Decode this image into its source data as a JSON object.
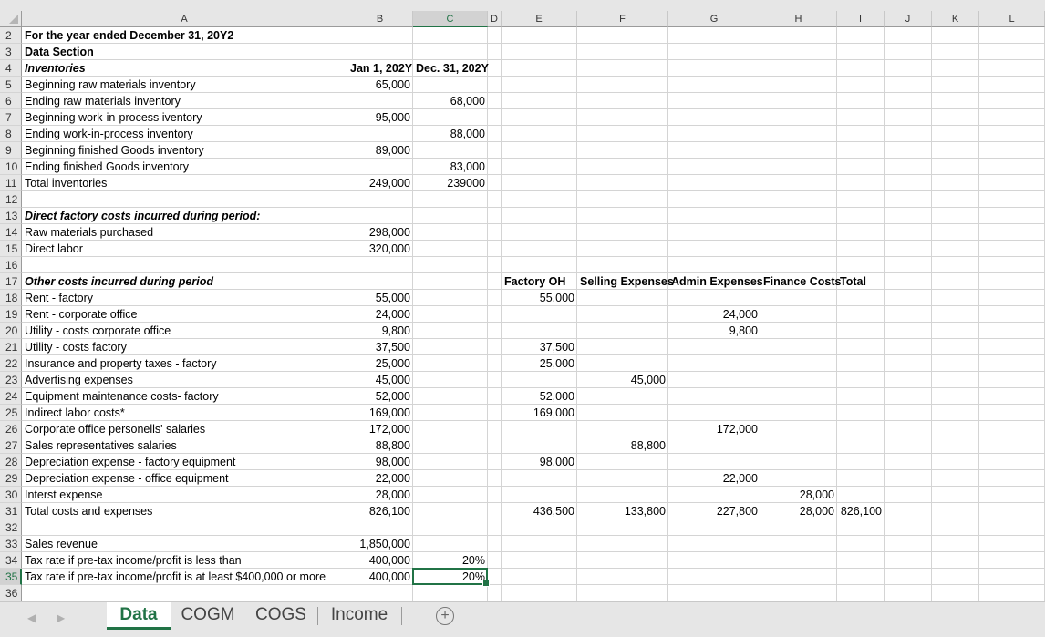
{
  "columns": [
    "A",
    "B",
    "C",
    "D",
    "E",
    "F",
    "G",
    "H",
    "I",
    "J",
    "K",
    "L"
  ],
  "selected_column": "C",
  "selected_row": "35",
  "rows": [
    {
      "num": "2",
      "A": "For the year ended December 31, 20Y2",
      "A_style": "b"
    },
    {
      "num": "3",
      "A": "Data Section",
      "A_style": "b"
    },
    {
      "num": "4",
      "A": "Inventories",
      "A_style": "bi",
      "B": "Jan 1, 202Y",
      "C": "Dec. 31, 202Y",
      "B_style": "b",
      "C_style": "b"
    },
    {
      "num": "5",
      "A": "Beginning raw materials inventory",
      "B": "65,000"
    },
    {
      "num": "6",
      "A": "Ending raw materials inventory",
      "C": "68,000"
    },
    {
      "num": "7",
      "A": "Beginning work-in-process iventory",
      "B": "95,000"
    },
    {
      "num": "8",
      "A": "Ending work-in-process inventory",
      "C": "88,000"
    },
    {
      "num": "9",
      "A": "Beginning finished Goods inventory",
      "B": "89,000"
    },
    {
      "num": "10",
      "A": "Ending finished Goods inventory",
      "C": "83,000"
    },
    {
      "num": "11",
      "A": "Total inventories",
      "B": "249,000",
      "C": "239000"
    },
    {
      "num": "12"
    },
    {
      "num": "13",
      "A": "Direct factory costs incurred during period:",
      "A_style": "bi"
    },
    {
      "num": "14",
      "A": "Raw materials purchased",
      "B": "298,000"
    },
    {
      "num": "15",
      "A": "Direct labor",
      "B": "320,000"
    },
    {
      "num": "16"
    },
    {
      "num": "17",
      "A": "Other costs incurred during period",
      "A_style": "bi",
      "E": "Factory OH",
      "F": "Selling Expenses",
      "G": "Admin Expenses",
      "H": "Finance Costs",
      "I": "Total",
      "E_style": "b",
      "F_style": "b",
      "G_style": "b",
      "H_style": "b",
      "I_style": "b"
    },
    {
      "num": "18",
      "A": "Rent - factory",
      "B": "55,000",
      "E": "55,000"
    },
    {
      "num": "19",
      "A": "Rent - corporate office",
      "B": "24,000",
      "G": "24,000"
    },
    {
      "num": "20",
      "A": "Utility - costs corporate office",
      "B": "9,800",
      "G": "9,800"
    },
    {
      "num": "21",
      "A": "Utility - costs factory",
      "B": "37,500",
      "E": "37,500"
    },
    {
      "num": "22",
      "A": "Insurance and property taxes - factory",
      "B": "25,000",
      "E": "25,000"
    },
    {
      "num": "23",
      "A": "Advertising expenses",
      "B": "45,000",
      "F": "45,000"
    },
    {
      "num": "24",
      "A": "Equipment maintenance costs- factory",
      "B": "52,000",
      "E": "52,000"
    },
    {
      "num": "25",
      "A": "Indirect labor costs*",
      "B": "169,000",
      "E": "169,000"
    },
    {
      "num": "26",
      "A": "Corporate office personells' salaries",
      "B": "172,000",
      "G": "172,000"
    },
    {
      "num": "27",
      "A": "Sales representatives salaries",
      "B": "88,800",
      "F": "88,800"
    },
    {
      "num": "28",
      "A": "Depreciation expense - factory equipment",
      "B": "98,000",
      "E": "98,000"
    },
    {
      "num": "29",
      "A": "Depreciation expense - office equipment",
      "B": "22,000",
      "G": "22,000"
    },
    {
      "num": "30",
      "A": "Interst expense",
      "B": "28,000",
      "H": "28,000"
    },
    {
      "num": "31",
      "A": "Total costs and expenses",
      "B": "826,100",
      "E": "436,500",
      "F": "133,800",
      "G": "227,800",
      "H": "28,000",
      "I": "826,100"
    },
    {
      "num": "32"
    },
    {
      "num": "33",
      "A": "Sales revenue",
      "B": "1,850,000"
    },
    {
      "num": "34",
      "A": "Tax rate if pre-tax income/profit is less than",
      "B": "400,000",
      "C": "20%"
    },
    {
      "num": "35",
      "A": "Tax rate if pre-tax income/profit is at least $400,000 or more",
      "B": "400,000",
      "C": "20%"
    },
    {
      "num": "36"
    }
  ],
  "sheet_tabs": [
    {
      "label": "Data",
      "active": true
    },
    {
      "label": "COGM",
      "active": false
    },
    {
      "label": "COGS",
      "active": false
    },
    {
      "label": "Income",
      "active": false
    }
  ],
  "add_sheet_symbol": "+",
  "nav_prev": "◀",
  "nav_next": "▶"
}
